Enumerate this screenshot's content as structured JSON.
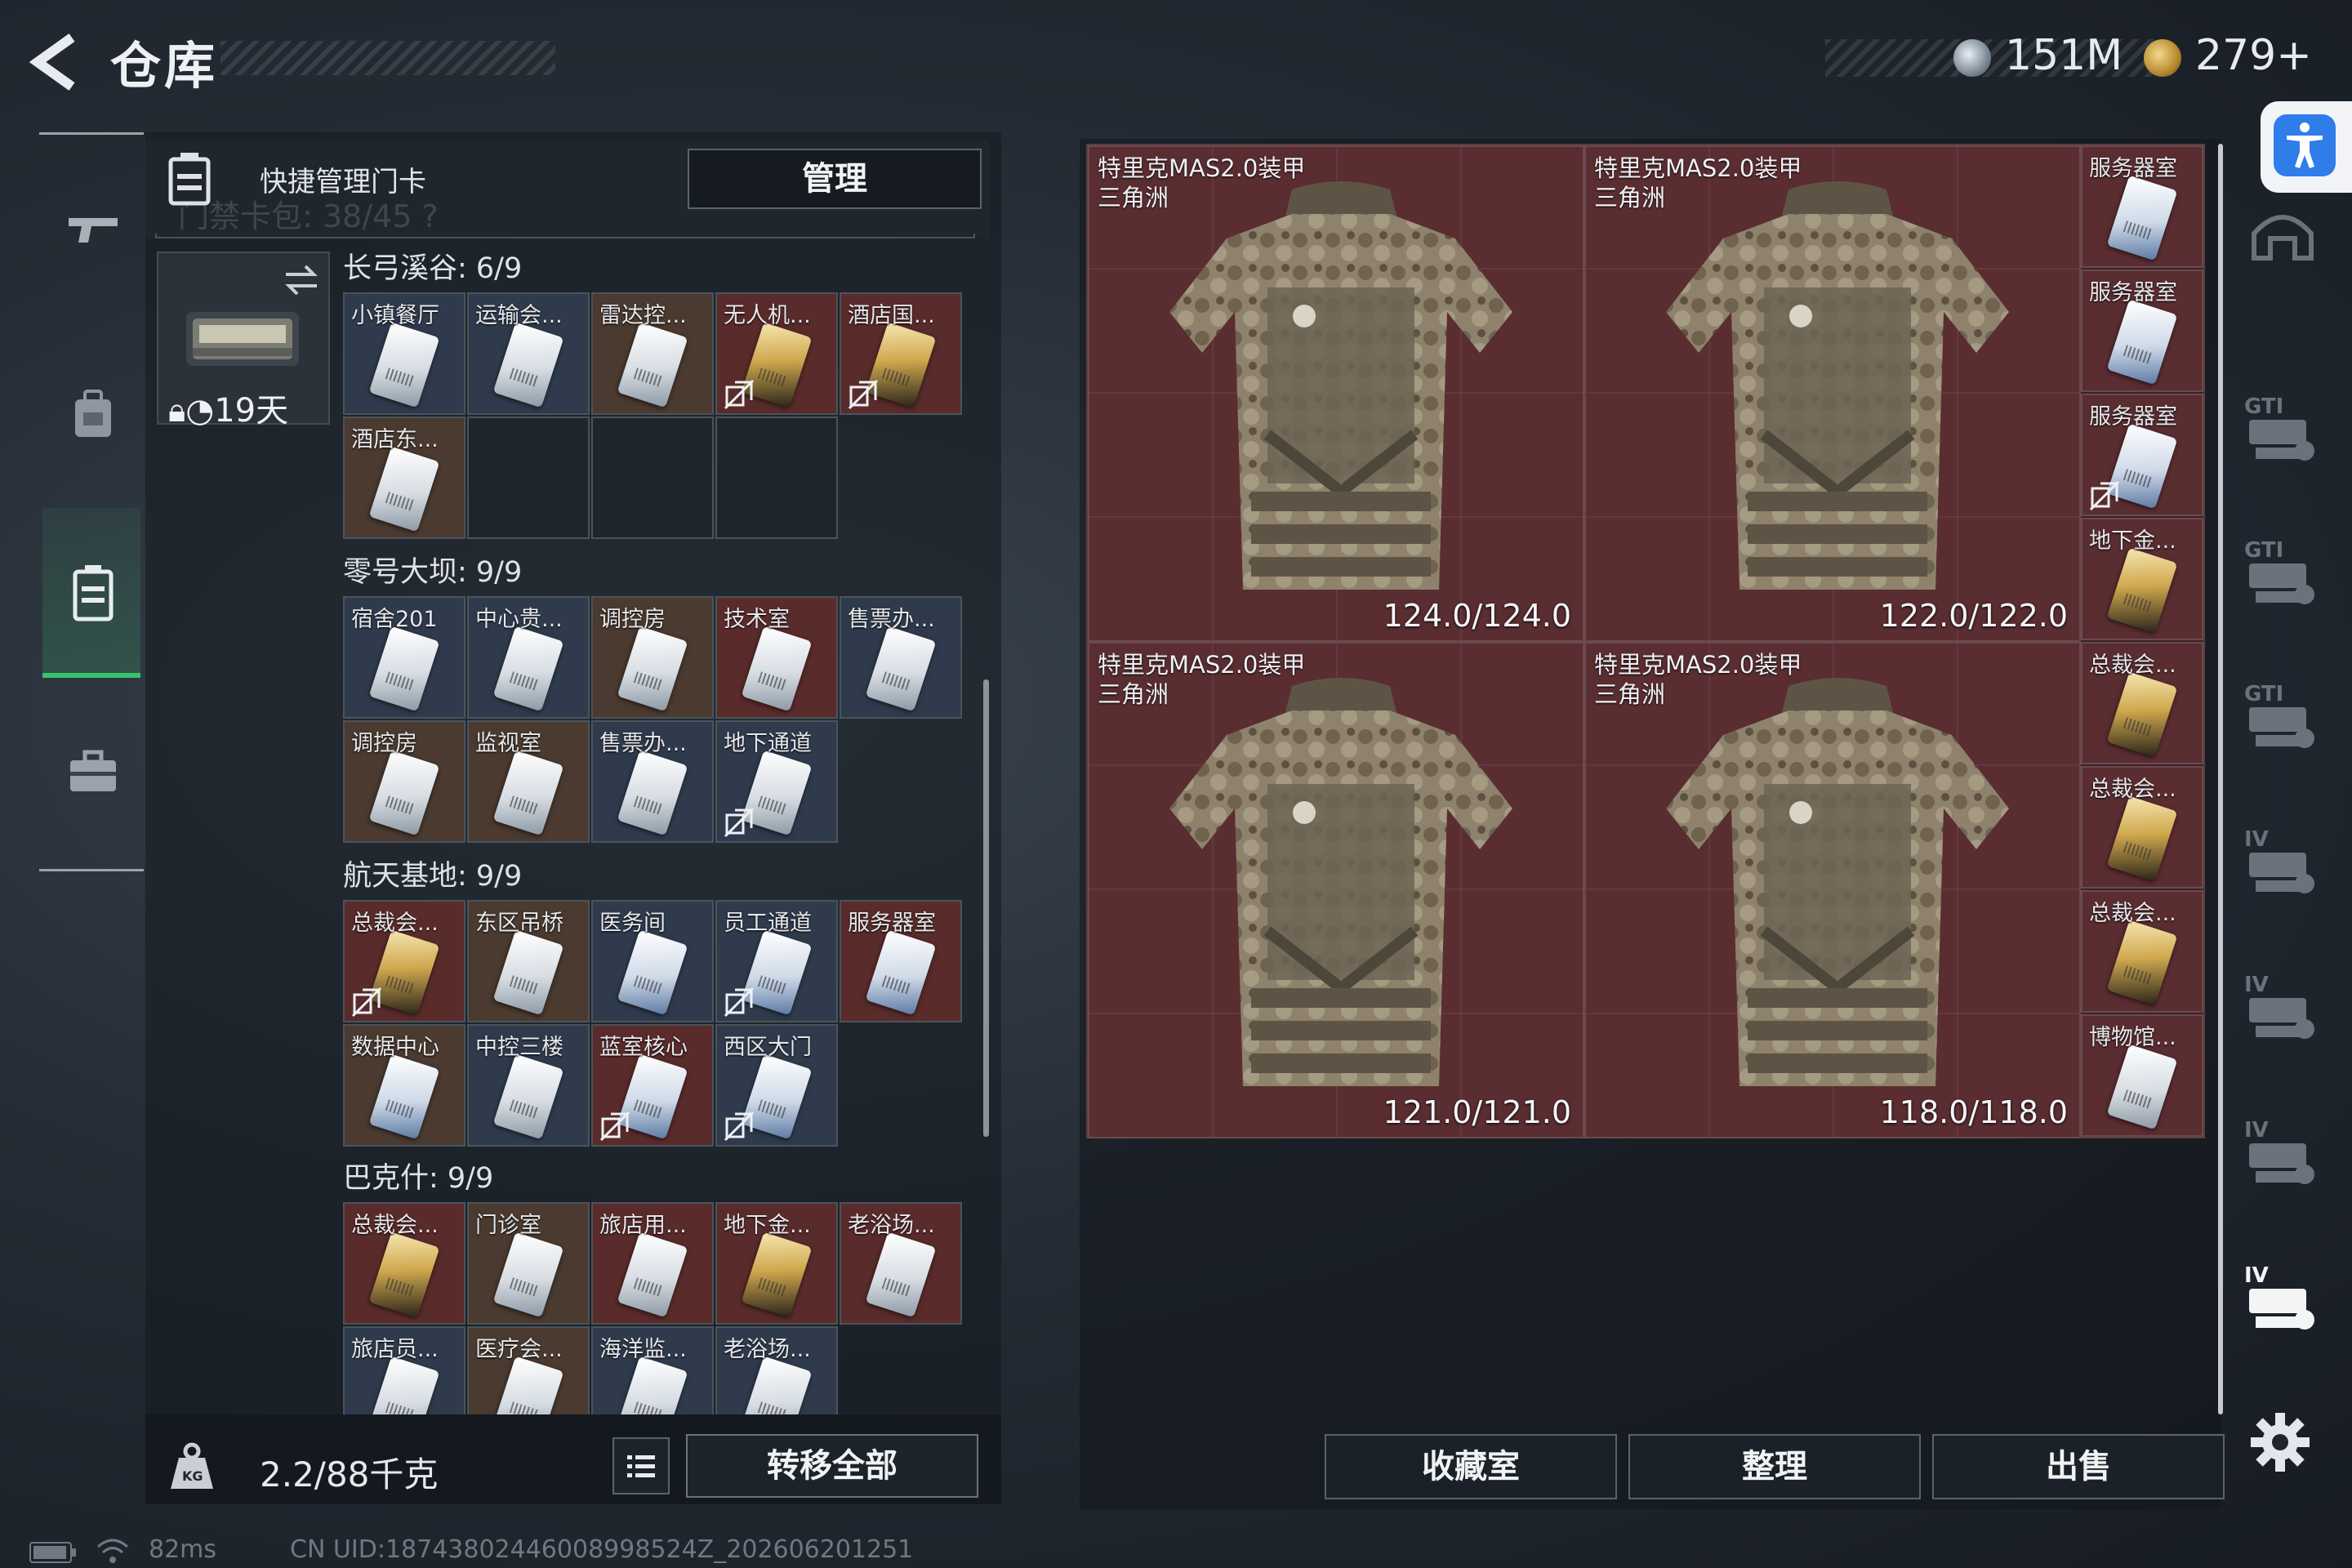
{
  "header": {
    "title": "仓库",
    "currencies": [
      {
        "icon": "silver-coin-icon",
        "value": "151M"
      },
      {
        "icon": "triangle-coin-icon",
        "value": "279+"
      }
    ]
  },
  "left_nav": {
    "items": [
      {
        "icon": "gun-icon",
        "active": false
      },
      {
        "icon": "backpack-icon",
        "active": false
      },
      {
        "icon": "keycard-case-icon",
        "active": true
      },
      {
        "icon": "toolbox-icon",
        "active": false
      }
    ]
  },
  "card_panel": {
    "title": "快捷管理门卡",
    "manage_label": "管理",
    "ghost_text": "门禁卡包: 38/45 ?",
    "keycase_timer": "19天",
    "sections": [
      {
        "title": "长弓溪谷: 6/9",
        "cells": [
          {
            "label": "小镇餐厅",
            "bg": "dark",
            "card": "white",
            "nobind": false
          },
          {
            "label": "运输会...",
            "bg": "dark",
            "card": "white",
            "nobind": false
          },
          {
            "label": "雷达控...",
            "bg": "brown",
            "card": "white",
            "nobind": false
          },
          {
            "label": "无人机...",
            "bg": "red",
            "card": "gold",
            "nobind": true
          },
          {
            "label": "酒店国...",
            "bg": "red",
            "card": "gold",
            "nobind": true
          },
          {
            "label": "酒店东...",
            "bg": "brown",
            "card": "white",
            "nobind": false
          },
          {
            "label": "",
            "bg": "empty",
            "card": "",
            "nobind": false
          },
          {
            "label": "",
            "bg": "empty",
            "card": "",
            "nobind": false
          },
          {
            "label": "",
            "bg": "empty",
            "card": "",
            "nobind": false
          }
        ]
      },
      {
        "title": "零号大坝: 9/9",
        "cells": [
          {
            "label": "宿舍201",
            "bg": "dark",
            "card": "white",
            "nobind": false
          },
          {
            "label": "中心贵...",
            "bg": "dark",
            "card": "white",
            "nobind": false
          },
          {
            "label": "调控房",
            "bg": "brown",
            "card": "white",
            "nobind": false
          },
          {
            "label": "技术室",
            "bg": "red",
            "card": "white",
            "nobind": false
          },
          {
            "label": "售票办...",
            "bg": "dark",
            "card": "white",
            "nobind": false
          },
          {
            "label": "调控房",
            "bg": "brown",
            "card": "white",
            "nobind": false
          },
          {
            "label": "监视室",
            "bg": "brown",
            "card": "white",
            "nobind": false
          },
          {
            "label": "售票办...",
            "bg": "dark",
            "card": "white",
            "nobind": false
          },
          {
            "label": "地下通道",
            "bg": "dark",
            "card": "white",
            "nobind": true
          }
        ]
      },
      {
        "title": "航天基地: 9/9",
        "cells": [
          {
            "label": "总裁会...",
            "bg": "red",
            "card": "gold",
            "nobind": true
          },
          {
            "label": "东区吊桥",
            "bg": "brown",
            "card": "white",
            "nobind": false
          },
          {
            "label": "医务间",
            "bg": "dark",
            "card": "blue",
            "nobind": false
          },
          {
            "label": "员工通道",
            "bg": "dark",
            "card": "blue",
            "nobind": true
          },
          {
            "label": "服务器室",
            "bg": "red",
            "card": "blue",
            "nobind": false
          },
          {
            "label": "数据中心",
            "bg": "brown",
            "card": "blue",
            "nobind": false
          },
          {
            "label": "中控三楼",
            "bg": "dark",
            "card": "white",
            "nobind": false
          },
          {
            "label": "蓝室核心",
            "bg": "red",
            "card": "blue",
            "nobind": true
          },
          {
            "label": "西区大门",
            "bg": "dark",
            "card": "blue",
            "nobind": true
          }
        ]
      },
      {
        "title": "巴克什: 9/9",
        "cells": [
          {
            "label": "总裁会...",
            "bg": "red",
            "card": "gold",
            "nobind": false
          },
          {
            "label": "门诊室",
            "bg": "brown",
            "card": "white",
            "nobind": false
          },
          {
            "label": "旅店用...",
            "bg": "red",
            "card": "white",
            "nobind": false
          },
          {
            "label": "地下金...",
            "bg": "red",
            "card": "gold",
            "nobind": false
          },
          {
            "label": "老浴场...",
            "bg": "red",
            "card": "white",
            "nobind": false
          },
          {
            "label": "旅店员...",
            "bg": "dark",
            "card": "white",
            "nobind": false
          },
          {
            "label": "医疗会...",
            "bg": "brown",
            "card": "white",
            "nobind": false
          },
          {
            "label": "海洋监...",
            "bg": "dark",
            "card": "white",
            "nobind": false
          },
          {
            "label": "老浴场...",
            "bg": "dark",
            "card": "white",
            "nobind": false
          }
        ]
      }
    ],
    "weight": "2.2/88千克",
    "transfer_all_label": "转移全部"
  },
  "stash": {
    "armors": [
      {
        "name": "特里克MAS2.0装甲",
        "map": "三角洲",
        "durability": "124.0/124.0"
      },
      {
        "name": "特里克MAS2.0装甲",
        "map": "三角洲",
        "durability": "122.0/122.0"
      },
      {
        "name": "特里克MAS2.0装甲",
        "map": "三角洲",
        "durability": "121.0/121.0"
      },
      {
        "name": "特里克MAS2.0装甲",
        "map": "三角洲",
        "durability": "118.0/118.0"
      }
    ],
    "side_cards": [
      {
        "label": "服务器室",
        "card": "blue",
        "nobind": false
      },
      {
        "label": "服务器室",
        "card": "blue",
        "nobind": false
      },
      {
        "label": "服务器室",
        "card": "blue",
        "nobind": true
      },
      {
        "label": "地下金...",
        "card": "gold",
        "nobind": false
      },
      {
        "label": "总裁会...",
        "card": "gold",
        "nobind": false
      },
      {
        "label": "总裁会...",
        "card": "gold",
        "nobind": false
      },
      {
        "label": "总裁会...",
        "card": "gold",
        "nobind": false
      },
      {
        "label": "博物馆...",
        "card": "white",
        "nobind": false
      }
    ],
    "buttons": {
      "collection": "收藏室",
      "sort": "整理",
      "sell": "出售"
    }
  },
  "right_rail": {
    "icons": [
      "dome-icon",
      "gti-armor-icon",
      "gti-helmet-icon",
      "gti-triangle-icon",
      "iv-rig-icon",
      "iv-rig-icon",
      "iv-rig-icon",
      "iv-rig-icon"
    ]
  },
  "status": {
    "ping": "82ms",
    "uid": "CN UID:18743802446008998524Z_202606201251"
  },
  "colors": {
    "accent_green": "#35c46a",
    "cell_red": "#5a2b2b",
    "accessibility_blue": "#2f7de9"
  }
}
